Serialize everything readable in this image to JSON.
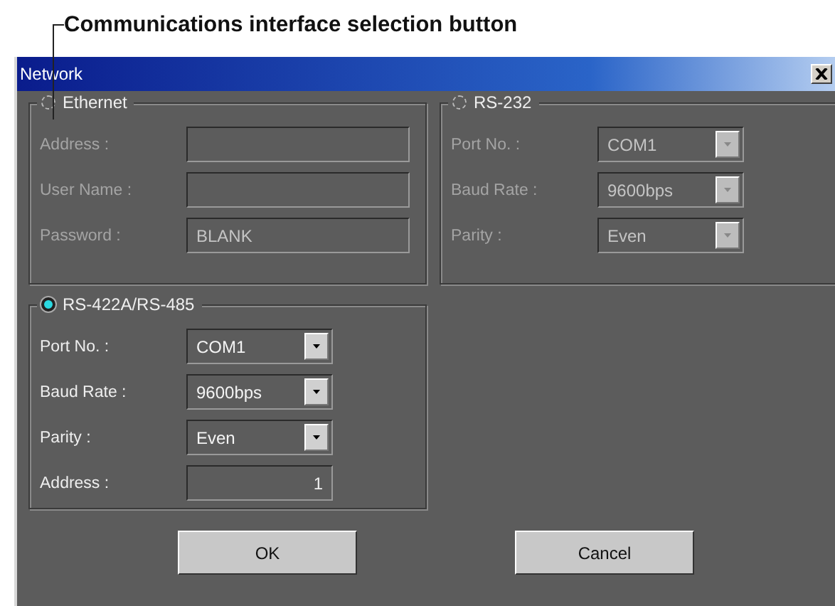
{
  "annotation": "Communications interface selection button",
  "window": {
    "title": "Network"
  },
  "groups": [
    {
      "label": "Ethernet",
      "selected": false,
      "disabled": true,
      "fields": [
        {
          "kind": "text",
          "label": "Address :"
        },
        {
          "kind": "text",
          "label": "User Name :"
        },
        {
          "kind": "text",
          "label": "Password :",
          "value": "BLANK"
        }
      ]
    },
    {
      "label": "RS-232",
      "selected": false,
      "disabled": true,
      "fields": [
        {
          "kind": "dropdown",
          "label": "Port No. :",
          "value": "COM1"
        },
        {
          "kind": "dropdown",
          "label": "Baud Rate :",
          "value": "9600bps"
        },
        {
          "kind": "dropdown",
          "label": "Parity :",
          "value": "Even"
        }
      ]
    },
    {
      "label": "RS-422A/RS-485",
      "selected": true,
      "disabled": false,
      "fields": [
        {
          "kind": "dropdown",
          "label": "Port No. :",
          "value": "COM1"
        },
        {
          "kind": "dropdown",
          "label": "Baud Rate :",
          "value": "9600bps"
        },
        {
          "kind": "dropdown",
          "label": "Parity :",
          "value": "Even"
        },
        {
          "kind": "number",
          "label": "Address :",
          "value": "1"
        }
      ]
    }
  ],
  "buttons": [
    "OK",
    "Cancel"
  ]
}
